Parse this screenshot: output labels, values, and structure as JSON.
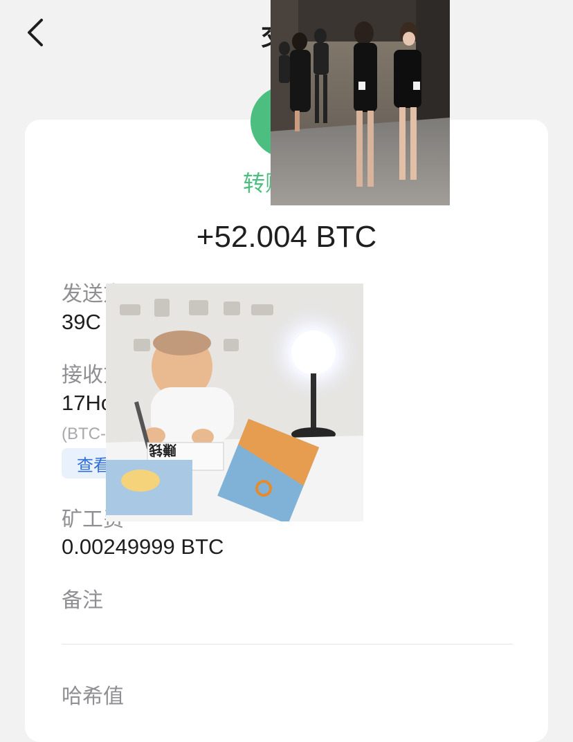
{
  "nav": {
    "title": "交易"
  },
  "transaction": {
    "status": "转账",
    "amount": "+52.004 BTC"
  },
  "details": {
    "sender_label": "发送方",
    "sender_value": "39C",
    "receiver_label": "接收方",
    "receiver_value": "17Ho",
    "receiver_network": "(BTC-",
    "view_button": "查看",
    "fee_label": "矿工费",
    "fee_value": "0.00249999 BTC",
    "memo_label": "备注",
    "hash_label": "哈希值"
  },
  "overlays": {
    "baby_book_text": "赚钱"
  },
  "colors": {
    "accent_green": "#4cbf80",
    "link_blue": "#2f6fd9",
    "background": "#f2f2f3",
    "card": "#ffffff"
  },
  "icons": {
    "back": "chevron-left-icon"
  }
}
